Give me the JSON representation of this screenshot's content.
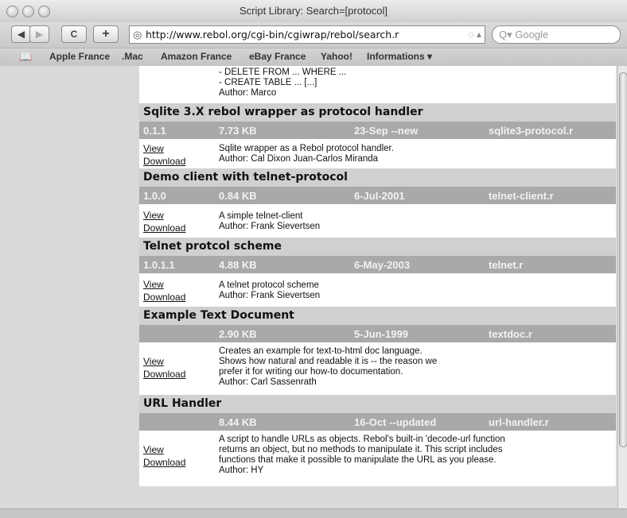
{
  "window": {
    "title": "Script Library: Search=[protocol]"
  },
  "toolbar": {
    "back_glyph": "◀",
    "forward_glyph": "▶",
    "reload_glyph": "C",
    "add_glyph": "+",
    "address": "http://www.rebol.org/cgi-bin/cgiwrap/rebol/search.r",
    "search_placeholder": "Q▾ Google"
  },
  "bookmarks": {
    "icon": "book-icon",
    "items": [
      "Apple France",
      ".Mac",
      "Amazon France",
      "eBay France",
      "Yahoo!",
      "Informations ▾"
    ]
  },
  "top_fragment": [
    "- DELETE FROM ... WHERE ...",
    "- CREATE TABLE ... [...]",
    "Author: Marco"
  ],
  "link_labels": {
    "view": "View",
    "download": "Download"
  },
  "scripts": [
    {
      "title": "Sqlite 3.X rebol wrapper as protocol handler",
      "version": "0.1.1",
      "size": "7.73 KB",
      "date": "23-Sep --new",
      "file": "sqlite3-protocol.r",
      "desc": [
        "Sqlite wrapper as a Rebol protocol handler.",
        "Author: Cal Dixon Juan-Carlos Miranda"
      ]
    },
    {
      "title": "Demo client with telnet-protocol",
      "version": "1.0.0",
      "size": "0.84 KB",
      "date": "6-Jul-2001",
      "file": "telnet-client.r",
      "desc": [
        "A simple telnet-client",
        "Author: Frank Sievertsen"
      ]
    },
    {
      "title": "Telnet protcol scheme",
      "version": "1.0.1.1",
      "size": "4.88 KB",
      "date": "6-May-2003",
      "file": "telnet.r",
      "desc": [
        "A telnet protocol scheme",
        "Author: Frank Sievertsen"
      ]
    },
    {
      "title": "Example Text Document",
      "version": "",
      "size": "2.90 KB",
      "date": "5-Jun-1999",
      "file": "textdoc.r",
      "desc": [
        "Creates an example for text-to-html doc language.",
        "Shows how natural and readable it is -- the reason we",
        "prefer it for writing our how-to documentation.",
        "Author: Carl Sassenrath"
      ]
    },
    {
      "title": "URL Handler",
      "version": "",
      "size": "8.44 KB",
      "date": "16-Oct --updated",
      "file": "url-handler.r",
      "desc": [
        "A script to handle URLs as objects. Rebol's built-in 'decode-url function",
        "returns an object, but no methods to manipulate it. This script includes",
        "functions that make it possible to manipulate the URL as you please.",
        "Author: HY"
      ]
    }
  ]
}
